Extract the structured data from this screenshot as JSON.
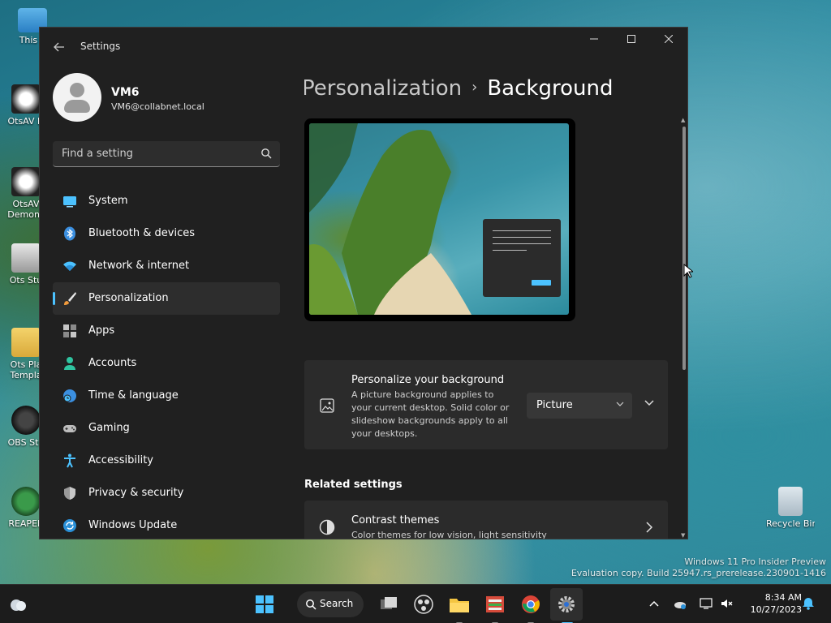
{
  "desktop": {
    "icons": [
      {
        "label": "This P"
      },
      {
        "label": "OtsAV D"
      },
      {
        "label": "OtsAV Demons"
      },
      {
        "label": "Ots Stu"
      },
      {
        "label": "Ots Pla Templa"
      },
      {
        "label": "OBS Stu"
      },
      {
        "label": "REAPER"
      }
    ],
    "recycle_bin": "Recycle Bin",
    "watermark_line1": "Windows 11 Pro Insider Preview",
    "watermark_line2": "Evaluation copy. Build 25947.rs_prerelease.230901-1416"
  },
  "window": {
    "title": "Settings",
    "profile": {
      "name": "VM6",
      "email": "VM6@collabnet.local"
    },
    "search": {
      "placeholder": "Find a setting"
    },
    "nav": [
      {
        "label": "System",
        "icon": "monitor-icon"
      },
      {
        "label": "Bluetooth & devices",
        "icon": "bluetooth-icon"
      },
      {
        "label": "Network & internet",
        "icon": "wifi-icon"
      },
      {
        "label": "Personalization",
        "icon": "brush-icon",
        "active": true
      },
      {
        "label": "Apps",
        "icon": "apps-icon"
      },
      {
        "label": "Accounts",
        "icon": "person-icon"
      },
      {
        "label": "Time & language",
        "icon": "globe-clock-icon"
      },
      {
        "label": "Gaming",
        "icon": "gamepad-icon"
      },
      {
        "label": "Accessibility",
        "icon": "accessibility-icon"
      },
      {
        "label": "Privacy & security",
        "icon": "shield-icon"
      },
      {
        "label": "Windows Update",
        "icon": "update-icon"
      }
    ],
    "breadcrumb": {
      "parent": "Personalization",
      "current": "Background"
    },
    "background_card": {
      "title": "Personalize your background",
      "description": "A picture background applies to your current desktop. Solid color or slideshow backgrounds apply to all your desktops.",
      "dropdown_value": "Picture"
    },
    "related_title": "Related settings",
    "contrast_card": {
      "title": "Contrast themes",
      "description": "Color themes for low vision, light sensitivity"
    }
  },
  "taskbar": {
    "search_label": "Search",
    "time": "8:34 AM",
    "date": "10/27/2023"
  },
  "colors": {
    "accent": "#4cc2ff",
    "window_bg": "#202020",
    "card_bg": "#2b2b2b"
  }
}
